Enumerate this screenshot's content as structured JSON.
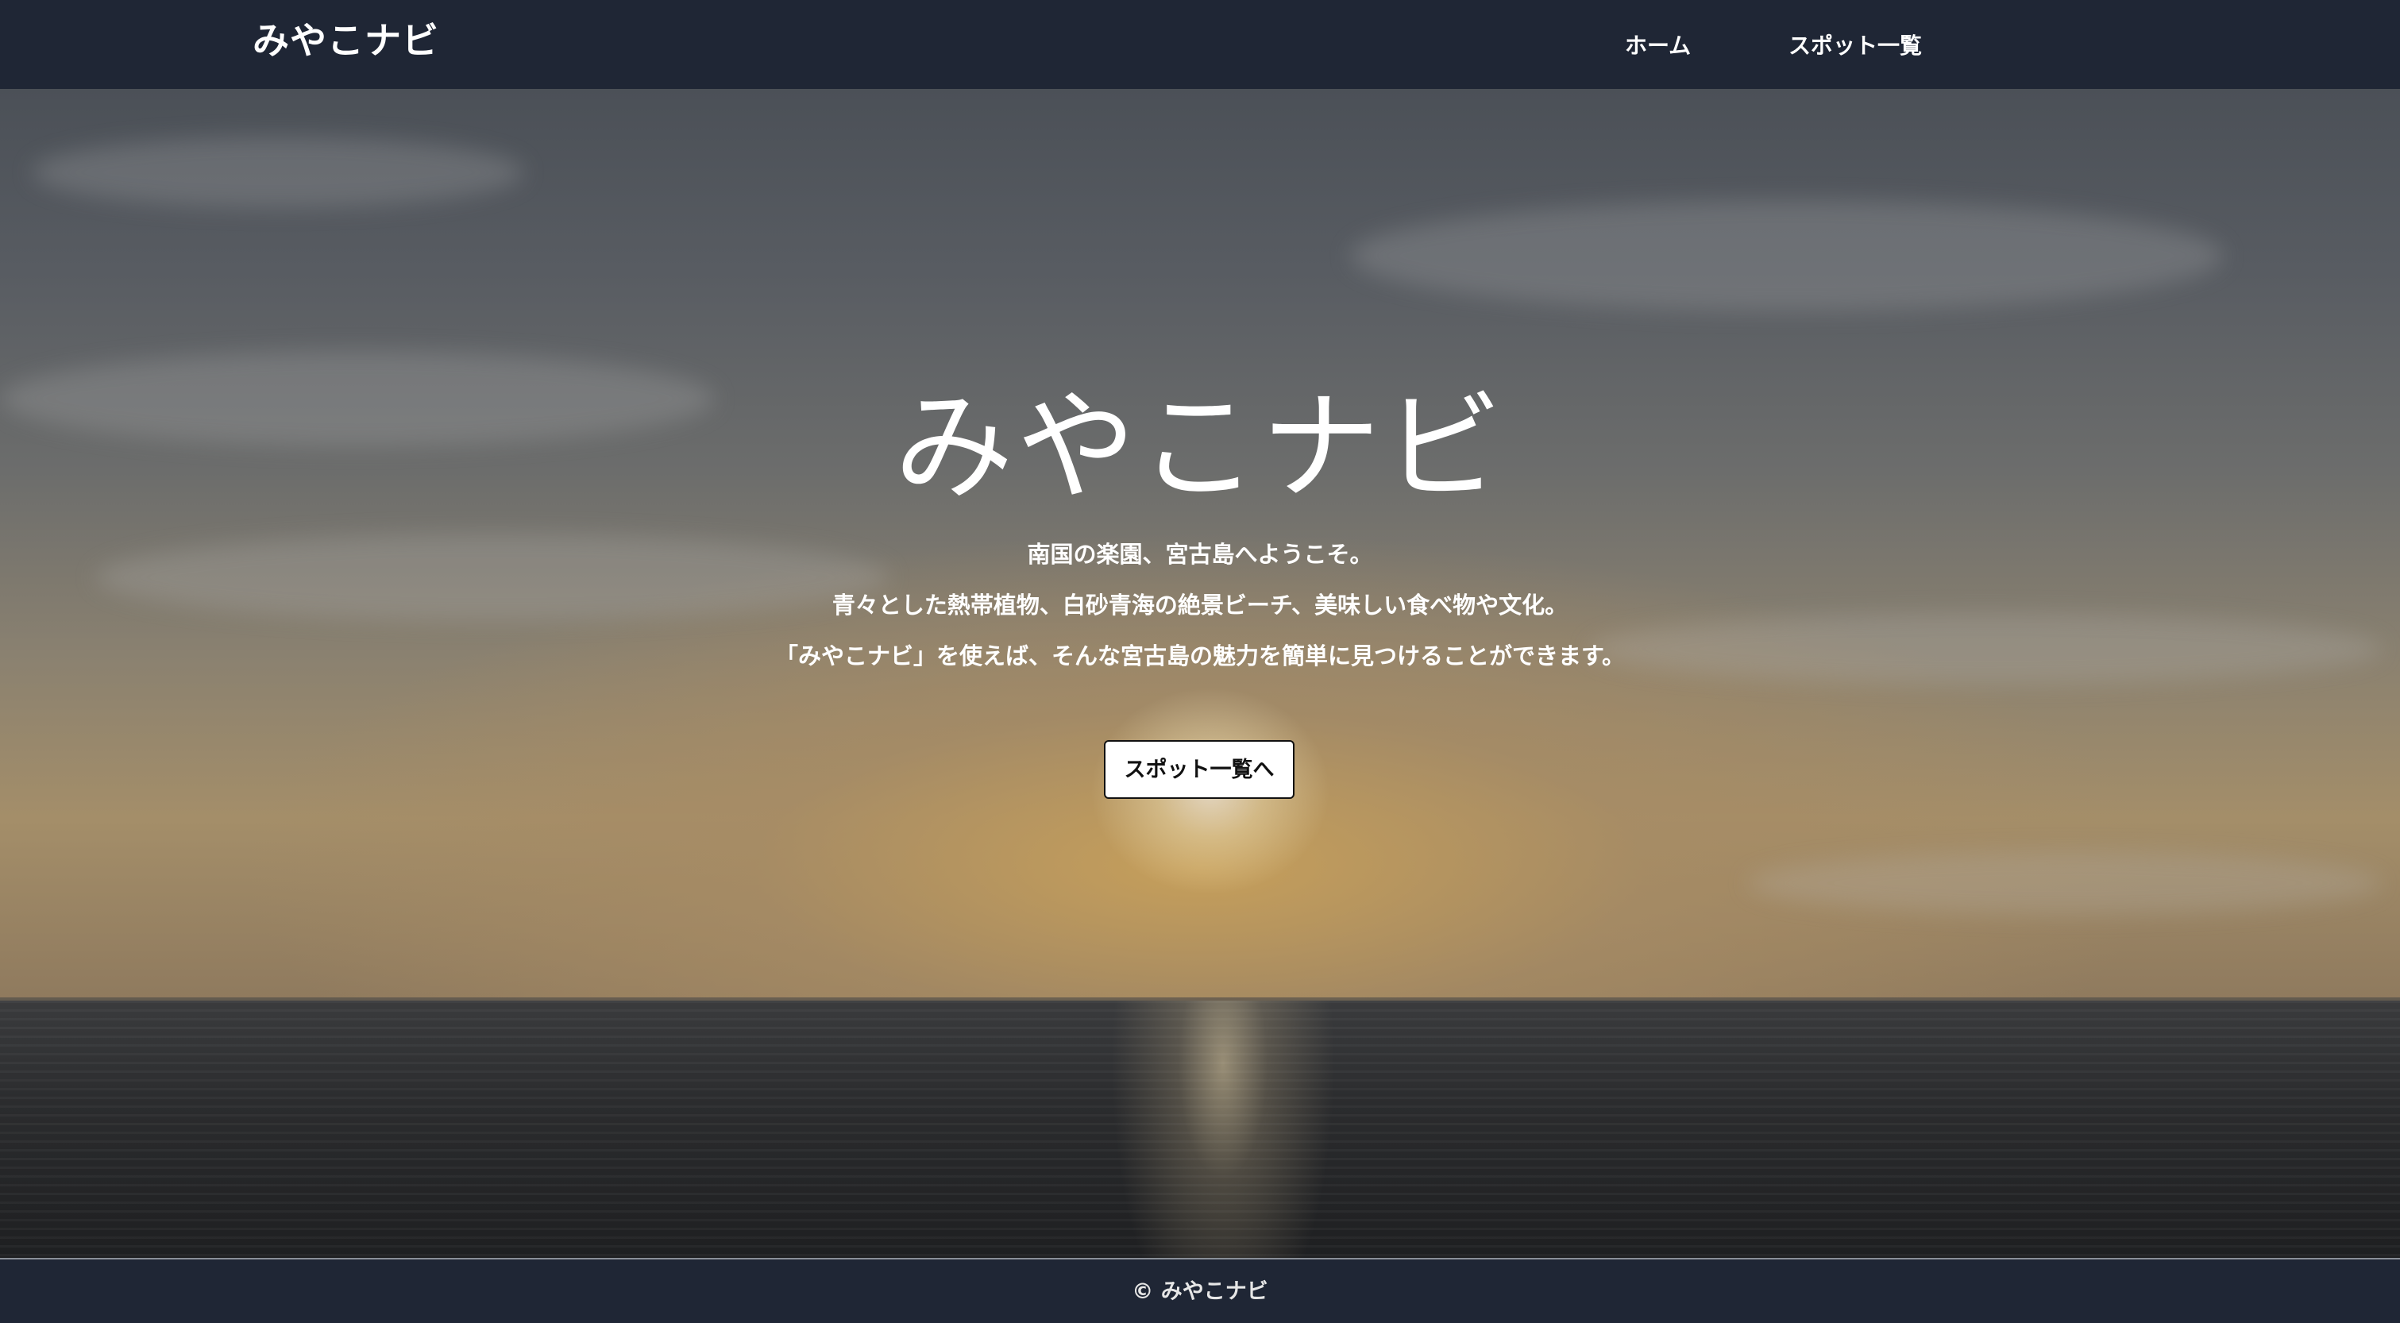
{
  "header": {
    "brand": "みやこナビ",
    "nav": [
      {
        "label": "ホーム"
      },
      {
        "label": "スポット一覧"
      }
    ]
  },
  "hero": {
    "title": "みやこナビ",
    "lines": [
      "南国の楽園、宮古島へようこそ。",
      "青々とした熱帯植物、白砂青海の絶景ビーチ、美味しい食べ物や文化。",
      "「みやこナビ」を使えば、そんな宮古島の魅力を簡単に見つけることができます。"
    ],
    "button_label": "スポット一覧へ"
  },
  "footer": {
    "copyright": "©  みやこナビ"
  },
  "colors": {
    "nav_background": "#1f2635",
    "text": "#ffffff"
  }
}
